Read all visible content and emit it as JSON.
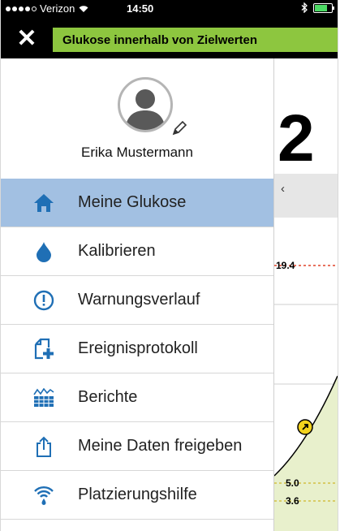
{
  "status_bar": {
    "carrier": "Verizon",
    "time": "14:50",
    "bluetooth": "bluetooth-icon"
  },
  "header": {
    "close_glyph": "✕",
    "banner_text": "Glukose innerhalb von Zielwerten",
    "banner_color": "#8dc63f"
  },
  "profile": {
    "name": "Erika Mustermann"
  },
  "menu": [
    {
      "label": "Meine Glukose",
      "icon": "home-icon",
      "active": true
    },
    {
      "label": "Kalibrieren",
      "icon": "drop-icon",
      "active": false
    },
    {
      "label": "Warnungsverlauf",
      "icon": "alert-circle-icon",
      "active": false
    },
    {
      "label": "Ereignisprotokoll",
      "icon": "add-document-icon",
      "active": false
    },
    {
      "label": "Berichte",
      "icon": "report-icon",
      "active": false
    },
    {
      "label": "Meine Daten freigeben",
      "icon": "share-icon",
      "active": false
    },
    {
      "label": "Platzierungshilfe",
      "icon": "signal-icon",
      "active": false
    }
  ],
  "glucose_view": {
    "big_value": "2",
    "back_glyph": "‹",
    "high_line_value": "19.4",
    "target_upper": "5.0",
    "target_lower": "3.6"
  },
  "colors": {
    "accent_blue": "#1f6fb5",
    "active_row": "#a2c0e2",
    "target_line": "#c8a800",
    "high_line": "#e0442a",
    "curve_green": "#e8f0cc"
  }
}
